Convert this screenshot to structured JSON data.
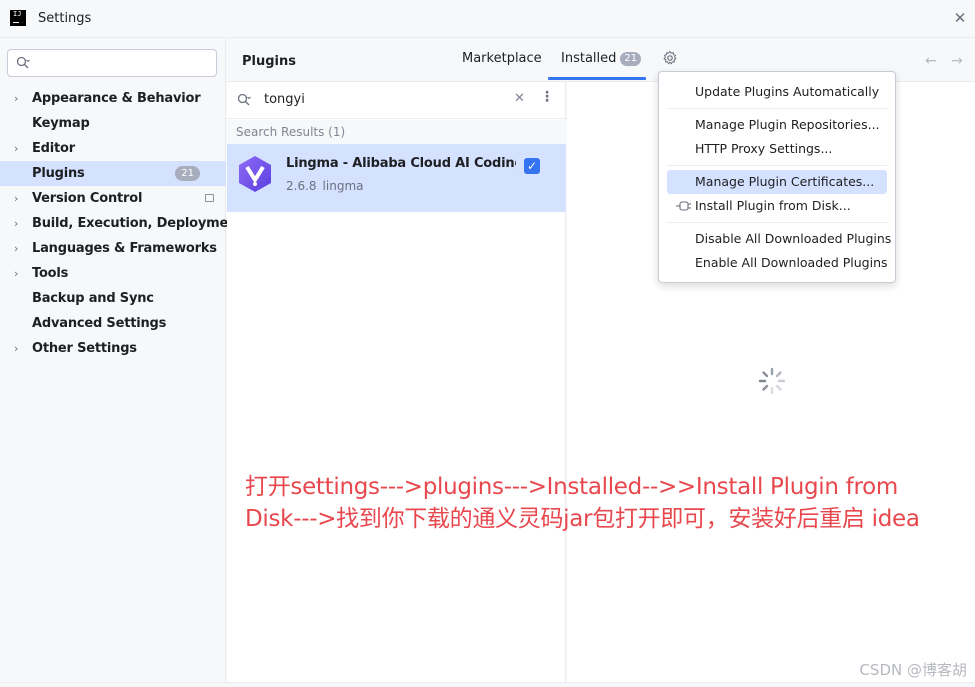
{
  "window": {
    "title": "Settings",
    "app_icon_text": "IJ"
  },
  "sidebar": {
    "search_placeholder": "",
    "items": [
      {
        "label": "Appearance & Behavior",
        "expandable": true
      },
      {
        "label": "Keymap",
        "expandable": false
      },
      {
        "label": "Editor",
        "expandable": true
      },
      {
        "label": "Plugins",
        "expandable": false,
        "selected": true,
        "badge": "21"
      },
      {
        "label": "Version Control",
        "expandable": true
      },
      {
        "label": "Build, Execution, Deployment",
        "expandable": true
      },
      {
        "label": "Languages & Frameworks",
        "expandable": true
      },
      {
        "label": "Tools",
        "expandable": true
      },
      {
        "label": "Backup and Sync",
        "expandable": false
      },
      {
        "label": "Advanced Settings",
        "expandable": false
      },
      {
        "label": "Other Settings",
        "expandable": true
      }
    ]
  },
  "header": {
    "title": "Plugins",
    "tabs": [
      {
        "label": "Marketplace"
      },
      {
        "label": "Installed",
        "badge": "21",
        "active": true
      }
    ]
  },
  "plugin_list": {
    "search_value": "tongyi",
    "results_header": "Search Results (1)",
    "plugins": [
      {
        "name": "Lingma - Alibaba Cloud AI Coding ...",
        "version": "2.6.8",
        "vendor": "lingma",
        "enabled": true
      }
    ]
  },
  "menu": {
    "items": [
      {
        "label": "Update Plugins Automatically"
      },
      {
        "label": "Manage Plugin Repositories..."
      },
      {
        "label": "HTTP Proxy Settings..."
      },
      {
        "label": "Manage Plugin Certificates...",
        "highlighted": true
      },
      {
        "label": "Install Plugin from Disk...",
        "icon": "plug-icon"
      },
      {
        "label": "Disable All Downloaded Plugins"
      },
      {
        "label": "Enable All Downloaded Plugins"
      }
    ]
  },
  "annotation": {
    "line1": "打开settings--->plugins--->Installed-->>Install Plugin from",
    "line2": "Disk--->找到你下载的通义灵码jar包打开即可，安装好后重启 idea"
  },
  "watermark": "CSDN @博客胡",
  "colors": {
    "accent": "#3574f0",
    "selection": "#d4e2ff",
    "annotation": "#e8484d",
    "badge": "#a8adbd"
  }
}
